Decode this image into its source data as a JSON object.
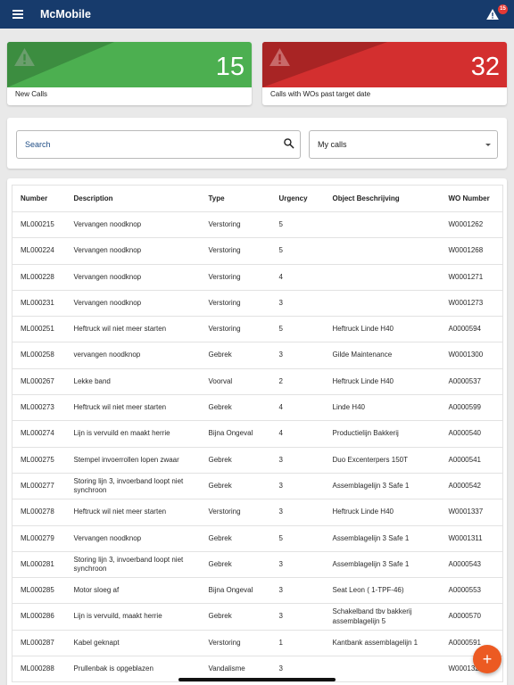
{
  "app": {
    "title": "McMobile",
    "alert_count": "15"
  },
  "stats": [
    {
      "value": "15",
      "label": "New Calls",
      "color": "#4caf50",
      "shade": "#3c8d40"
    },
    {
      "value": "32",
      "label": "Calls with WOs past target date",
      "color": "#d32f2f",
      "shade": "#a82424"
    }
  ],
  "filters": {
    "search_placeholder": "Search",
    "scope_selected": "My calls"
  },
  "table": {
    "columns": [
      "Number",
      "Description",
      "Type",
      "Urgency",
      "Object Beschrijving",
      "WO Number"
    ],
    "rows": [
      [
        "ML000215",
        "Vervangen noodknop",
        "Verstoring",
        "5",
        "",
        "W0001262"
      ],
      [
        "ML000224",
        "Vervangen noodknop",
        "Verstoring",
        "5",
        "",
        "W0001268"
      ],
      [
        "ML000228",
        "Vervangen noodknop",
        "Verstoring",
        "4",
        "",
        "W0001271"
      ],
      [
        "ML000231",
        "Vervangen noodknop",
        "Verstoring",
        "3",
        "",
        "W0001273"
      ],
      [
        "ML000251",
        "Heftruck wil niet meer starten",
        "Verstoring",
        "5",
        "Heftruck Linde H40",
        "A0000594"
      ],
      [
        "ML000258",
        "vervangen noodknop",
        "Gebrek",
        "3",
        "Gilde Maintenance",
        "W0001300"
      ],
      [
        "ML000267",
        "Lekke band",
        "Voorval",
        "2",
        "Heftruck Linde H40",
        "A0000537"
      ],
      [
        "ML000273",
        "Heftruck wil niet meer starten",
        "Gebrek",
        "4",
        "Linde H40",
        "A0000599"
      ],
      [
        "ML000274",
        "Lijn is vervuild en maakt herrie",
        "Bijna Ongeval",
        "4",
        "Productielijn Bakkerij",
        "A0000540"
      ],
      [
        "ML000275",
        "Stempel invoerrollen lopen zwaar",
        "Gebrek",
        "3",
        "Duo Excenterpers 150T",
        "A0000541"
      ],
      [
        "ML000277",
        "Storing lijn 3, invoerband loopt niet synchroon",
        "Gebrek",
        "3",
        "Assemblagelijn 3 Safe 1",
        "A0000542"
      ],
      [
        "ML000278",
        "Heftruck wil niet meer starten",
        "Verstoring",
        "3",
        "Heftruck Linde H40",
        "W0001337"
      ],
      [
        "ML000279",
        "Vervangen noodknop",
        "Gebrek",
        "5",
        "Assemblagelijn 3 Safe 1",
        "W0001311"
      ],
      [
        "ML000281",
        "Storing lijn 3, invoerband loopt niet synchroon",
        "Gebrek",
        "3",
        "Assemblagelijn 3 Safe 1",
        "A0000543"
      ],
      [
        "ML000285",
        "Motor sloeg af",
        "Bijna Ongeval",
        "3",
        "Seat Leon ( 1-TPF-46)",
        "A0000553"
      ],
      [
        "ML000286",
        "Lijn is vervuild, maakt herrie",
        "Gebrek",
        "3",
        "Schakelband tbv bakkerij assemblagelijn 5",
        "A0000570"
      ],
      [
        "ML000287",
        "Kabel geknapt",
        "Verstoring",
        "1",
        "Kantbank assemblagelijn 1",
        "A0000591"
      ],
      [
        "ML000288",
        "Prullenbak is opgeblazen",
        "Vandalisme",
        "3",
        "",
        "W000132"
      ]
    ]
  },
  "fab": {
    "icon": "plus-icon",
    "glyph": "+"
  }
}
